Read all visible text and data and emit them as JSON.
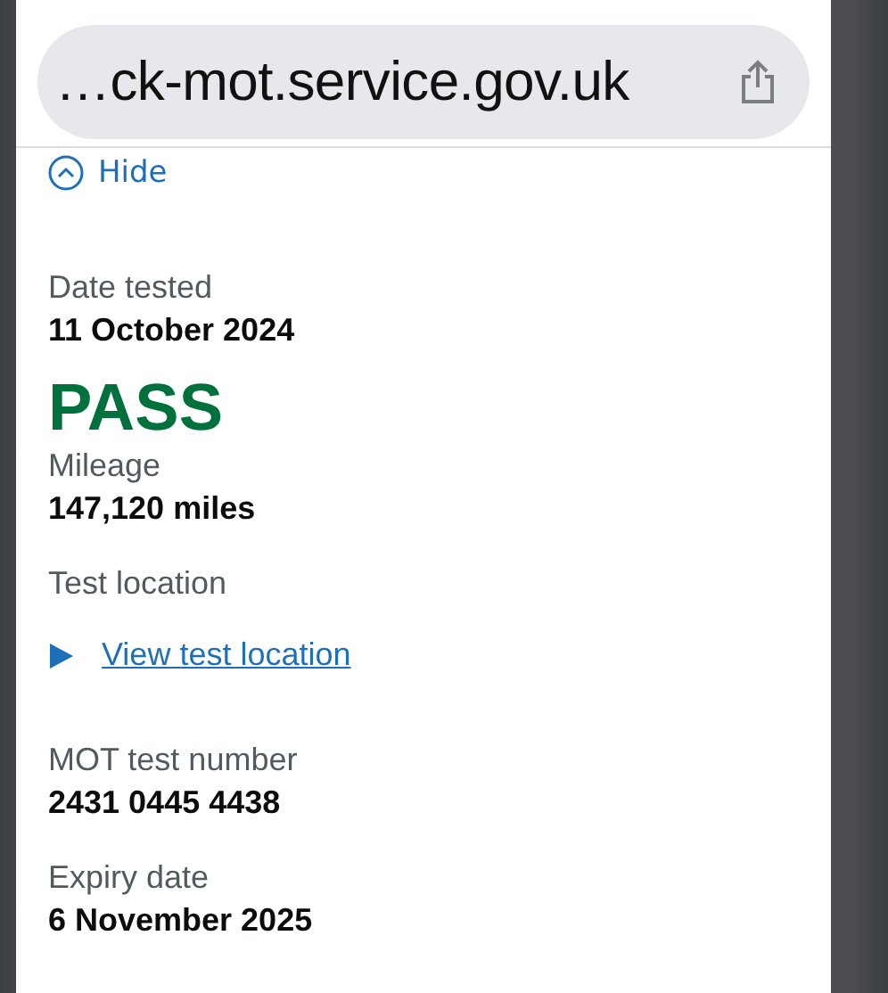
{
  "address_bar": {
    "url": "…ck-mot.service.gov.uk"
  },
  "hide_link": {
    "label": "Hide"
  },
  "details": [
    {
      "kind": "field",
      "label": "Date tested",
      "value": "11 October 2024"
    },
    {
      "kind": "result",
      "value": "PASS"
    },
    {
      "kind": "field",
      "label": "Mileage",
      "value": "147,120 miles"
    },
    {
      "kind": "disclosure",
      "label": "Test location",
      "link": "View test location",
      "expanded": false
    },
    {
      "kind": "field",
      "label": "MOT test number",
      "value": "2431 0445 4438"
    },
    {
      "kind": "field",
      "label": "Expiry date",
      "value": "6 November 2025"
    }
  ]
}
